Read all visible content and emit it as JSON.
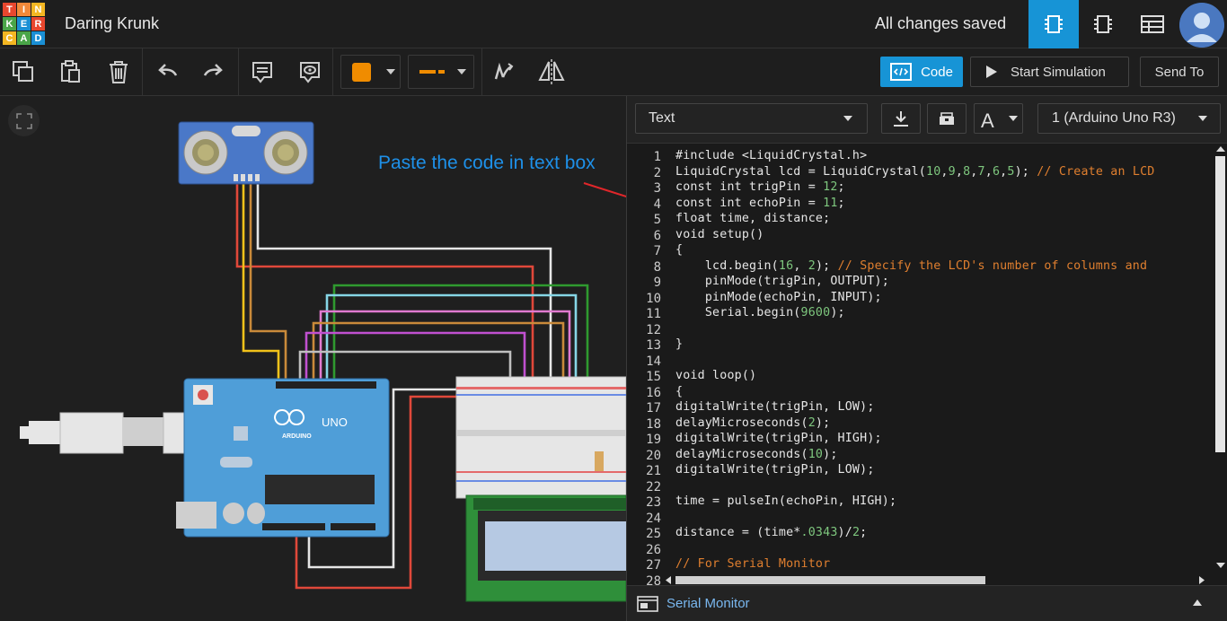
{
  "app": {
    "logo_letters": [
      "T",
      "I",
      "N",
      "K",
      "E",
      "R",
      "C",
      "A",
      "D"
    ],
    "logo_colors": [
      "#e8472e",
      "#f2893a",
      "#f4b722",
      "#4aa548",
      "#1a8fd4",
      "#e8472e",
      "#f4b722",
      "#4aa548",
      "#1a8fd4"
    ],
    "project_name": "Daring Krunk",
    "save_status": "All changes saved",
    "accent_color": "#1794d6"
  },
  "header": {
    "views": [
      "circuit-view-icon",
      "schematic-view-icon",
      "component-list-icon"
    ]
  },
  "toolbar": {
    "code_label": "Code",
    "simulate_label": "Start Simulation",
    "send_to_label": "Send To",
    "wire_color": "#f08c00"
  },
  "canvas": {
    "annotation": "Paste the code in text box",
    "arduino_label": "UNO",
    "arduino_brand": "ARDUINO"
  },
  "code_panel": {
    "mode": "Text",
    "device": "1 (Arduino Uno R3)",
    "serial_monitor_label": "Serial Monitor",
    "lines": [
      "#include <LiquidCrystal.h>",
      "LiquidCrystal lcd = LiquidCrystal(10,9,8,7,6,5); // Create an LCD",
      "const int trigPin = 12;",
      "const int echoPin = 11;",
      "float time, distance;",
      "void setup()",
      "{",
      "    lcd.begin(16, 2); // Specify the LCD's number of columns and",
      "    pinMode(trigPin, OUTPUT);",
      "    pinMode(echoPin, INPUT);",
      "    Serial.begin(9600);",
      "",
      "}",
      "",
      "void loop()",
      "{",
      "digitalWrite(trigPin, LOW);",
      "delayMicroseconds(2);",
      "digitalWrite(trigPin, HIGH);",
      "delayMicroseconds(10);",
      "digitalWrite(trigPin, LOW);",
      "",
      "time = pulseIn(echoPin, HIGH);",
      "",
      "distance = (time*.0343)/2;",
      "",
      "// For Serial Monitor",
      ""
    ]
  }
}
